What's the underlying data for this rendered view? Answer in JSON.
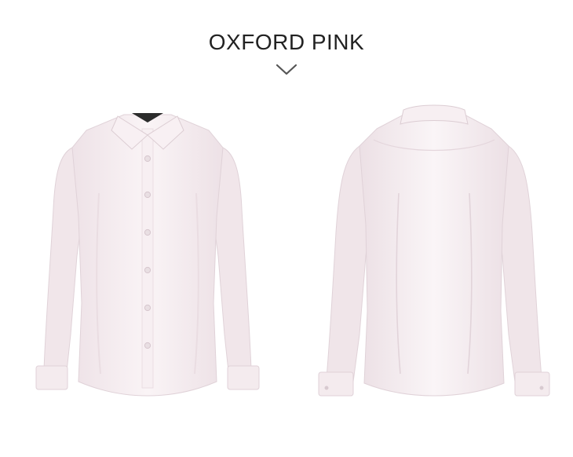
{
  "heading": {
    "title": "OXFORD PINK"
  },
  "icons": {
    "scroll": "chevron-down-icon"
  },
  "colors": {
    "background": "#ffffff",
    "shirt": "#f6eef0",
    "shirt_shadow": "#e6d9de",
    "button": "#e9dfe3",
    "collar_label": "#2c2c2c"
  },
  "photos": [
    {
      "view": "front"
    },
    {
      "view": "back"
    }
  ]
}
